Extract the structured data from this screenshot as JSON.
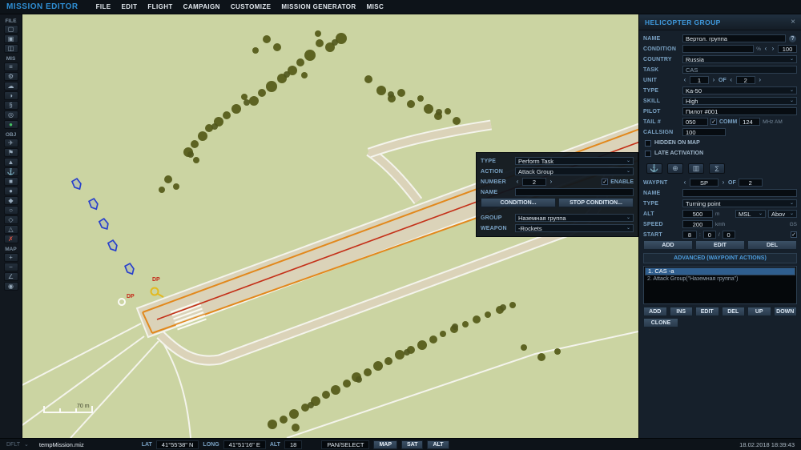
{
  "ui": {
    "caret": "⌄",
    "left": "‹",
    "right": "›",
    "check": "✓",
    "close": "×",
    "help": "?",
    "colon": ":",
    "slash": "/"
  },
  "titlebar": {
    "app_title": "MISSION EDITOR",
    "menus": [
      "FILE",
      "EDIT",
      "FLIGHT",
      "CAMPAIGN",
      "CUSTOMIZE",
      "MISSION GENERATOR",
      "MISC"
    ]
  },
  "left_toolbar": {
    "sections": {
      "file": {
        "label": "FILE",
        "icons": [
          {
            "name": "new-mission-icon",
            "glyph": "▢"
          },
          {
            "name": "open-mission-icon",
            "glyph": "▣"
          },
          {
            "name": "save-mission-icon",
            "glyph": "◫"
          }
        ]
      },
      "mis": {
        "label": "MIS",
        "icons": [
          {
            "name": "briefing-icon",
            "glyph": "≡"
          },
          {
            "name": "mission-options-icon",
            "glyph": "⚙"
          },
          {
            "name": "weather-icon",
            "glyph": "☁"
          },
          {
            "name": "time-icon",
            "glyph": "◑"
          },
          {
            "name": "rules-icon",
            "glyph": "§"
          },
          {
            "name": "goals-icon",
            "glyph": "◎"
          },
          {
            "name": "start-mission-icon",
            "glyph": "●",
            "cls": "green"
          }
        ]
      },
      "obj": {
        "label": "OBJ",
        "icons": [
          {
            "name": "airplane-group-icon",
            "glyph": "✈"
          },
          {
            "name": "helicopter-group-icon",
            "glyph": "⚑"
          },
          {
            "name": "vehicle-group-icon",
            "glyph": "▲"
          },
          {
            "name": "ship-group-icon",
            "glyph": "⚓"
          },
          {
            "name": "static-object-icon",
            "glyph": "■"
          },
          {
            "name": "template-icon",
            "glyph": "●"
          },
          {
            "name": "trigger-zone-icon",
            "glyph": "◆"
          },
          {
            "name": "bullseye-icon",
            "glyph": "○"
          },
          {
            "name": "farp-icon",
            "glyph": "◇"
          },
          {
            "name": "initial-point-icon",
            "glyph": "△"
          },
          {
            "name": "delete-object-icon",
            "glyph": "✗",
            "cls": "red"
          }
        ]
      },
      "map": {
        "label": "MAP",
        "icons": [
          {
            "name": "zoom-in-icon",
            "glyph": "+"
          },
          {
            "name": "zoom-out-icon",
            "glyph": "−"
          },
          {
            "name": "measure-icon",
            "glyph": "∠"
          },
          {
            "name": "label-toggle-icon",
            "glyph": "◉"
          }
        ]
      }
    }
  },
  "map": {
    "scale_label": "70 m",
    "dp1": "DP",
    "dp2": "DP"
  },
  "task_dialog": {
    "type_label": "TYPE",
    "type_value": "Perform Task",
    "action_label": "ACTION",
    "action_value": "Attack Group",
    "number_label": "NUMBER",
    "number_value": "2",
    "enable_label": "ENABLE",
    "name_label": "NAME",
    "name_value": "",
    "condition_button": "CONDITION...",
    "stop_condition_button": "STOP CONDITION...",
    "group_label": "GROUP",
    "group_value": "Наземная группа",
    "weapon_label": "WEAPON",
    "weapon_value": "-Rockets"
  },
  "group_panel": {
    "title": "HELICOPTER GROUP",
    "fields": {
      "name_label": "NAME",
      "name_value": "Вертол. группа",
      "condition_label": "CONDITION",
      "percent": "%",
      "condition_value": "100",
      "country_label": "COUNTRY",
      "country_value": "Russia",
      "task_label": "TASK",
      "task_value": "CAS",
      "unit_label": "UNIT",
      "unit_value": "1",
      "of_label": "OF",
      "unit_count": "2",
      "type_label": "TYPE",
      "type_value": "Ka-50",
      "skill_label": "SKILL",
      "skill_value": "High",
      "pilot_label": "PILOT",
      "pilot_value": "Пилот #001",
      "tail_label": "TAIL #",
      "tail_value": "050",
      "comm_label": "COMM",
      "comm_value": "124",
      "mhz_label": "MHz AM",
      "callsign_label": "CALLSIGN",
      "callsign_value": "100",
      "hidden_label": "HIDDEN ON MAP",
      "late_label": "LATE ACTIVATION"
    },
    "waypoint_tabs": [
      {
        "name": "nav-route-tab-icon",
        "glyph": "⚓"
      },
      {
        "name": "targeting-tab-icon",
        "glyph": "⊕"
      },
      {
        "name": "payload-tab-icon",
        "glyph": "▥"
      },
      {
        "name": "summary-tab-icon",
        "glyph": "Σ"
      }
    ],
    "waypoint": {
      "waypnt_label": "WAYPNT",
      "waypnt_value": "SP",
      "of_label": "OF",
      "waypnt_count": "2",
      "name_label": "NAME",
      "name_value": "",
      "type_label": "TYPE",
      "type_value": "Turning point",
      "alt_label": "ALT",
      "alt_value": "500",
      "alt_unit": "m",
      "alt_ref1": "MSL",
      "alt_ref2": "Abov",
      "speed_label": "SPEED",
      "speed_value": "200",
      "speed_unit": "kmh",
      "gs_label": "GS",
      "start_label": "START",
      "start_h": "8",
      "start_m": "0",
      "start_s": "0",
      "add": "ADD",
      "edit": "EDIT",
      "del": "DEL",
      "advanced": "ADVANCED (WAYPOINT ACTIONS)"
    },
    "actions": [
      {
        "t": "1. CAS -a",
        "cls": "sel"
      },
      {
        "t": "2. Attack Group(\"Наземная группа\")"
      }
    ],
    "action_buttons": [
      "ADD",
      "INS",
      "EDIT",
      "DEL",
      "UP",
      "DOWN"
    ],
    "clone_button": "CLONE"
  },
  "statusbar": {
    "dflt": "DFLT",
    "mission": "tempMission.miz",
    "lat_label": "LAT",
    "lat_value": "41°55'38\" N",
    "long_label": "LONG",
    "long_value": "41°51'16\" E",
    "alt_label": "ALT",
    "alt_value": "18",
    "mode": "PAN/SELECT",
    "map_btn": "MAP",
    "sat_btn": "SAT",
    "alt_btn": "ALT",
    "datetime": "18.02.2018 18:39:43"
  }
}
